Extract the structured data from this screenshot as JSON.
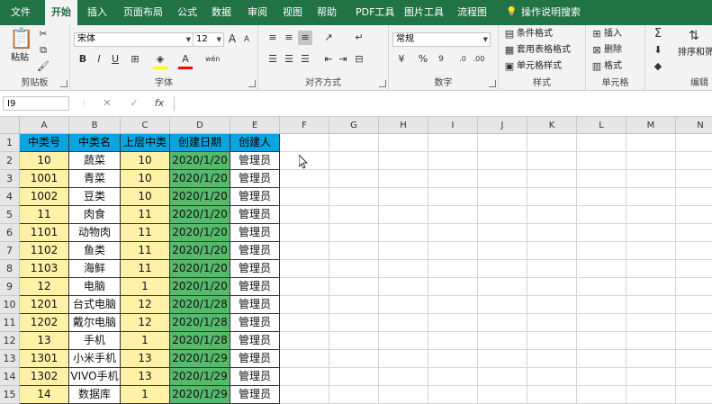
{
  "menu": {
    "tabs": [
      "文件",
      "开始",
      "插入",
      "页面布局",
      "公式",
      "数据",
      "审阅",
      "视图",
      "帮助",
      "PDF工具",
      "图片工具",
      "流程图"
    ],
    "search": "操作说明搜索"
  },
  "ribbon": {
    "clipboard": {
      "label": "剪贴板",
      "paste": "粘贴"
    },
    "font": {
      "label": "字体",
      "name": "宋体",
      "size": "12",
      "bold": "B",
      "italic": "I",
      "underline": "U",
      "grow": "A",
      "shrink": "A",
      "color": "A",
      "wen": "wén"
    },
    "alignment": {
      "label": "对齐方式"
    },
    "number": {
      "label": "数字",
      "format": "常规",
      "percent": "%"
    },
    "styles": {
      "label": "样式",
      "conditional": "条件格式",
      "table": "套用表格格式",
      "cell": "单元格样式"
    },
    "cells": {
      "label": "单元格",
      "insert": "插入",
      "delete": "删除",
      "format": "格式"
    },
    "editing": {
      "label": "编辑",
      "sort": "排序和筛"
    }
  },
  "formula_bar": {
    "name_box": "I9",
    "cancel": "✕",
    "enter": "✓",
    "fx": "fx",
    "value": ""
  },
  "columns": [
    "A",
    "B",
    "C",
    "D",
    "E",
    "F",
    "G",
    "H",
    "I",
    "J",
    "K",
    "L",
    "M",
    "N"
  ],
  "rows": [
    "1",
    "2",
    "3",
    "4",
    "5",
    "6",
    "7",
    "8",
    "9",
    "10",
    "11",
    "12",
    "13",
    "14",
    "15"
  ],
  "table": {
    "headers": [
      "中类号",
      "中类名",
      "上层中类",
      "创建日期",
      "创建人"
    ],
    "data": [
      [
        "10",
        "蔬菜",
        "10",
        "2020/1/20",
        "管理员"
      ],
      [
        "1001",
        "青菜",
        "10",
        "2020/1/20",
        "管理员"
      ],
      [
        "1002",
        "豆类",
        "10",
        "2020/1/20",
        "管理员"
      ],
      [
        "11",
        "肉食",
        "11",
        "2020/1/20",
        "管理员"
      ],
      [
        "1101",
        "动物肉",
        "11",
        "2020/1/20",
        "管理员"
      ],
      [
        "1102",
        "鱼类",
        "11",
        "2020/1/20",
        "管理员"
      ],
      [
        "1103",
        "海鲜",
        "11",
        "2020/1/20",
        "管理员"
      ],
      [
        "12",
        "电脑",
        "1",
        "2020/1/20",
        "管理员"
      ],
      [
        "1201",
        "台式电脑",
        "12",
        "2020/1/28",
        "管理员"
      ],
      [
        "1202",
        "戴尔电脑",
        "12",
        "2020/1/28",
        "管理员"
      ],
      [
        "13",
        "手机",
        "1",
        "2020/1/28",
        "管理员"
      ],
      [
        "1301",
        "小米手机",
        "13",
        "2020/1/29",
        "管理员"
      ],
      [
        "1302",
        "VIVO手机",
        "13",
        "2020/1/29",
        "管理员"
      ],
      [
        "14",
        "数据库",
        "1",
        "2020/1/29",
        "管理员"
      ]
    ]
  },
  "colors": {
    "accent": "#217346",
    "header_fill": "#0aa4e0",
    "col_a_c_fill": "#fff2a8",
    "date_fill": "#57b96b"
  }
}
